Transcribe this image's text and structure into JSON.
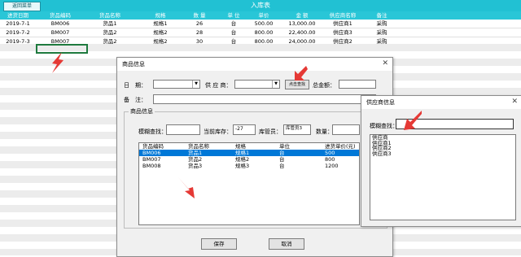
{
  "sheet": {
    "back_button": "返回菜单",
    "title": "入库表",
    "columns": [
      "进货日期",
      "货品编码",
      "货品名称",
      "规格",
      "数 量",
      "单 位",
      "单价",
      "金 额",
      "供应商名称",
      "备注"
    ],
    "rows": [
      [
        "2019-7-1",
        "BM006",
        "货品1",
        "规格1",
        "26",
        "台",
        "500.00",
        "13,000.00",
        "供应商1",
        "采购"
      ],
      [
        "2019-7-2",
        "BM007",
        "货品2",
        "规格2",
        "28",
        "台",
        "800.00",
        "22,400.00",
        "供应商3",
        "采购"
      ],
      [
        "2019-7-3",
        "BM007",
        "货品2",
        "规格2",
        "30",
        "台",
        "800.00",
        "24,000.00",
        "供应商2",
        "采购"
      ]
    ]
  },
  "product_dialog": {
    "title": "商品信息",
    "date_label": "日　期：",
    "supplier_label": "供 应 商：",
    "search_button": "点击查找",
    "total_label": "总金额：",
    "remark_label": "备　注：",
    "group_title": "商品信息",
    "fuzzy_label": "模糊查找：",
    "stock_label": "当前库存：",
    "stock_value": "-27",
    "keeper_label": "库管员：",
    "keeper_value": "库管员3",
    "qty_label": "数量：",
    "list_headers": [
      "货品编码",
      "货品名称",
      "规格",
      "单位",
      "进货单价(元)"
    ],
    "list_rows": [
      [
        "BM006",
        "货品1",
        "规格1",
        "台",
        "500"
      ],
      [
        "BM007",
        "货品2",
        "规格2",
        "台",
        "800"
      ],
      [
        "BM008",
        "货品3",
        "规格3",
        "台",
        "1200"
      ]
    ],
    "selected_row": 0,
    "save_button": "保存",
    "cancel_button": "取消"
  },
  "supplier_dialog": {
    "title": "供应商信息",
    "fuzzy_label": "模糊查找：",
    "items": [
      "供应商",
      "供应商1",
      "供应商2",
      "供应商3"
    ]
  },
  "colors": {
    "header_bar": "#21c1d3",
    "selection": "#0078d7",
    "arrow": "#e53935"
  }
}
